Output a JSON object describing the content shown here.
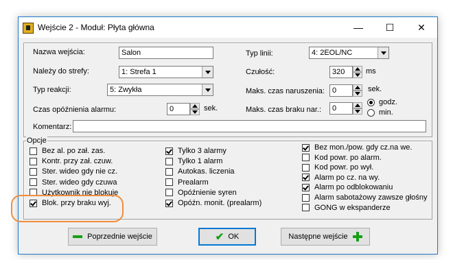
{
  "window": {
    "title": "Wejście 2 - Moduł: Płyta główna",
    "min": "—",
    "max": "☐",
    "close": "✕"
  },
  "top": {
    "name_label": "Nazwa wejścia:",
    "name_value": "Salon",
    "zone_label": "Należy do strefy:",
    "zone_value": "1: Strefa  1",
    "reaction_label": "Typ reakcji:",
    "reaction_value": "5: Zwykła",
    "alarm_delay_label": "Czas opóźnienia alarmu:",
    "alarm_delay_value": "0",
    "alarm_delay_unit": "sek.",
    "line_type_label": "Typ linii:",
    "line_type_value": "4: 2EOL/NC",
    "sensitivity_label": "Czułość:",
    "sensitivity_value": "320",
    "sensitivity_unit": "ms",
    "max_violation_label": "Maks. czas naruszenia:",
    "max_violation_value": "0",
    "max_violation_unit": "sek.",
    "max_no_violation_label": "Maks. czas braku nar.:",
    "max_no_violation_value": "0",
    "unit_hours": "godz.",
    "unit_minutes": "min.",
    "comment_label": "Komentarz:",
    "comment_value": ""
  },
  "options": {
    "title": "Opcje",
    "col1": [
      {
        "label": "Bez al. po zał. zas.",
        "checked": false
      },
      {
        "label": "Kontr. przy zał. czuw.",
        "checked": false
      },
      {
        "label": "Ster. wideo gdy nie cz.",
        "checked": false
      },
      {
        "label": "Ster. wideo gdy czuwa",
        "checked": false
      },
      {
        "label": "Użytkownik nie blokuje",
        "checked": false
      },
      {
        "label": "Blok. przy braku wyj.",
        "checked": true
      }
    ],
    "col2": [
      {
        "label": "Tylko 3 alarmy",
        "checked": true
      },
      {
        "label": "Tylko 1 alarm",
        "checked": false
      },
      {
        "label": "Autokas. liczenia",
        "checked": false
      },
      {
        "label": "Prealarm",
        "checked": false
      },
      {
        "label": "Opóźnienie syren",
        "checked": false
      },
      {
        "label": "Opóźn. monit. (prealarm)",
        "checked": true
      }
    ],
    "col3": [
      {
        "label": "Bez mon./pow. gdy cz.na we.",
        "checked": true
      },
      {
        "label": "Kod powr. po alarm.",
        "checked": false
      },
      {
        "label": "Kod powr. po wył.",
        "checked": false
      },
      {
        "label": "Alarm po cz. na wy.",
        "checked": true
      },
      {
        "label": "Alarm po odblokowaniu",
        "checked": true
      },
      {
        "label": "Alarm sabotażowy zawsze głośny",
        "checked": false
      },
      {
        "label": "GONG w ekspanderze",
        "checked": false
      }
    ]
  },
  "buttons": {
    "prev": "Poprzednie wejście",
    "ok": "OK",
    "next": "Następne wejście"
  },
  "colors": {
    "accent": "#15a015",
    "highlight": "#f08c3c",
    "window_border": "#1e78c8"
  }
}
